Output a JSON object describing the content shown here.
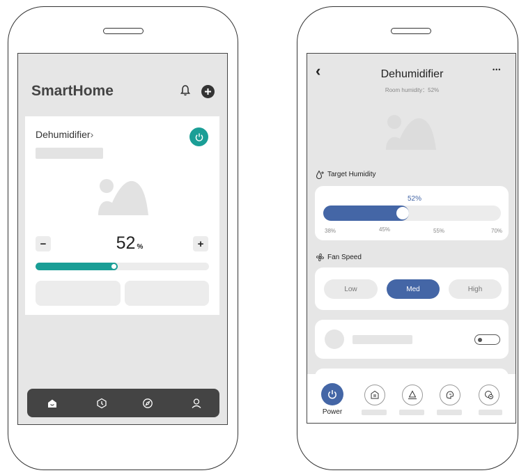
{
  "left_phone": {
    "app_title": "SmartHome",
    "device_name": "Dehumidifier",
    "device_chevron": "›",
    "humidity_value": "52",
    "humidity_unit": "%",
    "minus_label": "−",
    "plus_label": "+",
    "humidity_level_fraction": 0.46,
    "accent_color": "#1a9e96"
  },
  "right_phone": {
    "back_label": "‹",
    "title": "Dehumidifier",
    "subtitle": "Room humidity：52%",
    "more_label": "•••",
    "target_humidity": {
      "label": "Target Humidity",
      "value_label": "52%",
      "level_fraction": 0.46,
      "ticks": [
        "38%",
        "45%",
        "55%",
        "70%"
      ]
    },
    "fan_speed": {
      "label": "Fan Speed",
      "options": [
        "Low",
        "Med",
        "High"
      ],
      "selected": "Med"
    },
    "power_label": "Power",
    "accent_color": "#4466a6"
  }
}
